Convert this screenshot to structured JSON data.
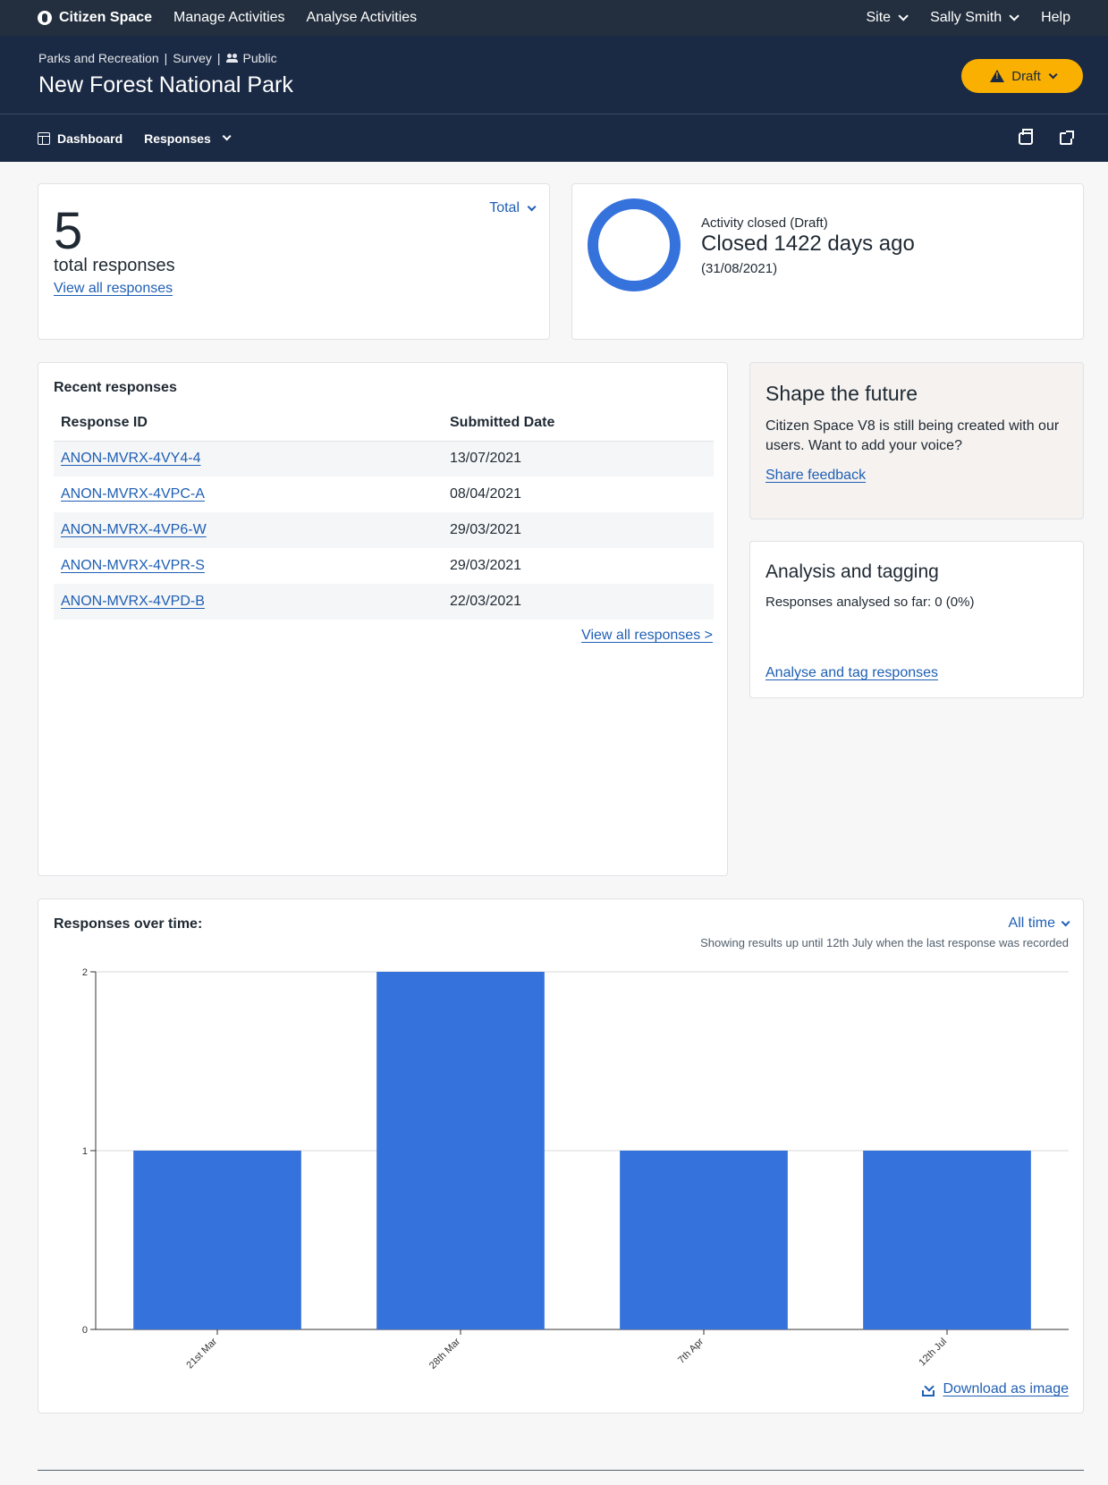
{
  "topnav": {
    "brand": "Citizen Space",
    "links": [
      "Manage Activities",
      "Analyse Activities"
    ],
    "site": "Site",
    "user": "Sally Smith",
    "help": "Help"
  },
  "header": {
    "crumb_org": "Parks and Recreation",
    "crumb_type": "Survey",
    "crumb_visibility": "Public",
    "title": "New Forest National Park",
    "status": "Draft"
  },
  "subnav": {
    "dashboard": "Dashboard",
    "responses": "Responses"
  },
  "total_card": {
    "count": "5",
    "label": "total responses",
    "link": "View all responses",
    "dropdown": "Total"
  },
  "closed_card": {
    "status": "Activity closed (Draft)",
    "headline": "Closed 1422 days ago",
    "date": "(31/08/2021)"
  },
  "recent": {
    "title": "Recent responses",
    "col_id": "Response ID",
    "col_date": "Submitted Date",
    "rows": [
      {
        "id": "ANON-MVRX-4VY4-4",
        "date": "13/07/2021"
      },
      {
        "id": "ANON-MVRX-4VPC-A",
        "date": "08/04/2021"
      },
      {
        "id": "ANON-MVRX-4VP6-W",
        "date": "29/03/2021"
      },
      {
        "id": "ANON-MVRX-4VPR-S",
        "date": "29/03/2021"
      },
      {
        "id": "ANON-MVRX-4VPD-B",
        "date": "22/03/2021"
      }
    ],
    "more": "View all responses >"
  },
  "shape": {
    "title": "Shape the future",
    "text": "Citizen Space V8 is still being created with our users. Want to add your voice?",
    "link": "Share feedback"
  },
  "analysis": {
    "title": "Analysis and tagging",
    "text": "Responses analysed so far: 0 (0%)",
    "link": "Analyse and tag responses"
  },
  "chart": {
    "title": "Responses over time:",
    "range": "All time",
    "note": "Showing results up until 12th July when the last response was recorded",
    "download": "Download as image"
  },
  "chart_data": {
    "type": "bar",
    "title": "Responses over time:",
    "categories": [
      "21st Mar",
      "28th Mar",
      "7th Apr",
      "12th Jul"
    ],
    "values": [
      1,
      2,
      1,
      1
    ],
    "ylim": [
      0,
      2
    ],
    "yticks": [
      0,
      1,
      2
    ],
    "grid": true,
    "bar_color": "#3572dc"
  }
}
